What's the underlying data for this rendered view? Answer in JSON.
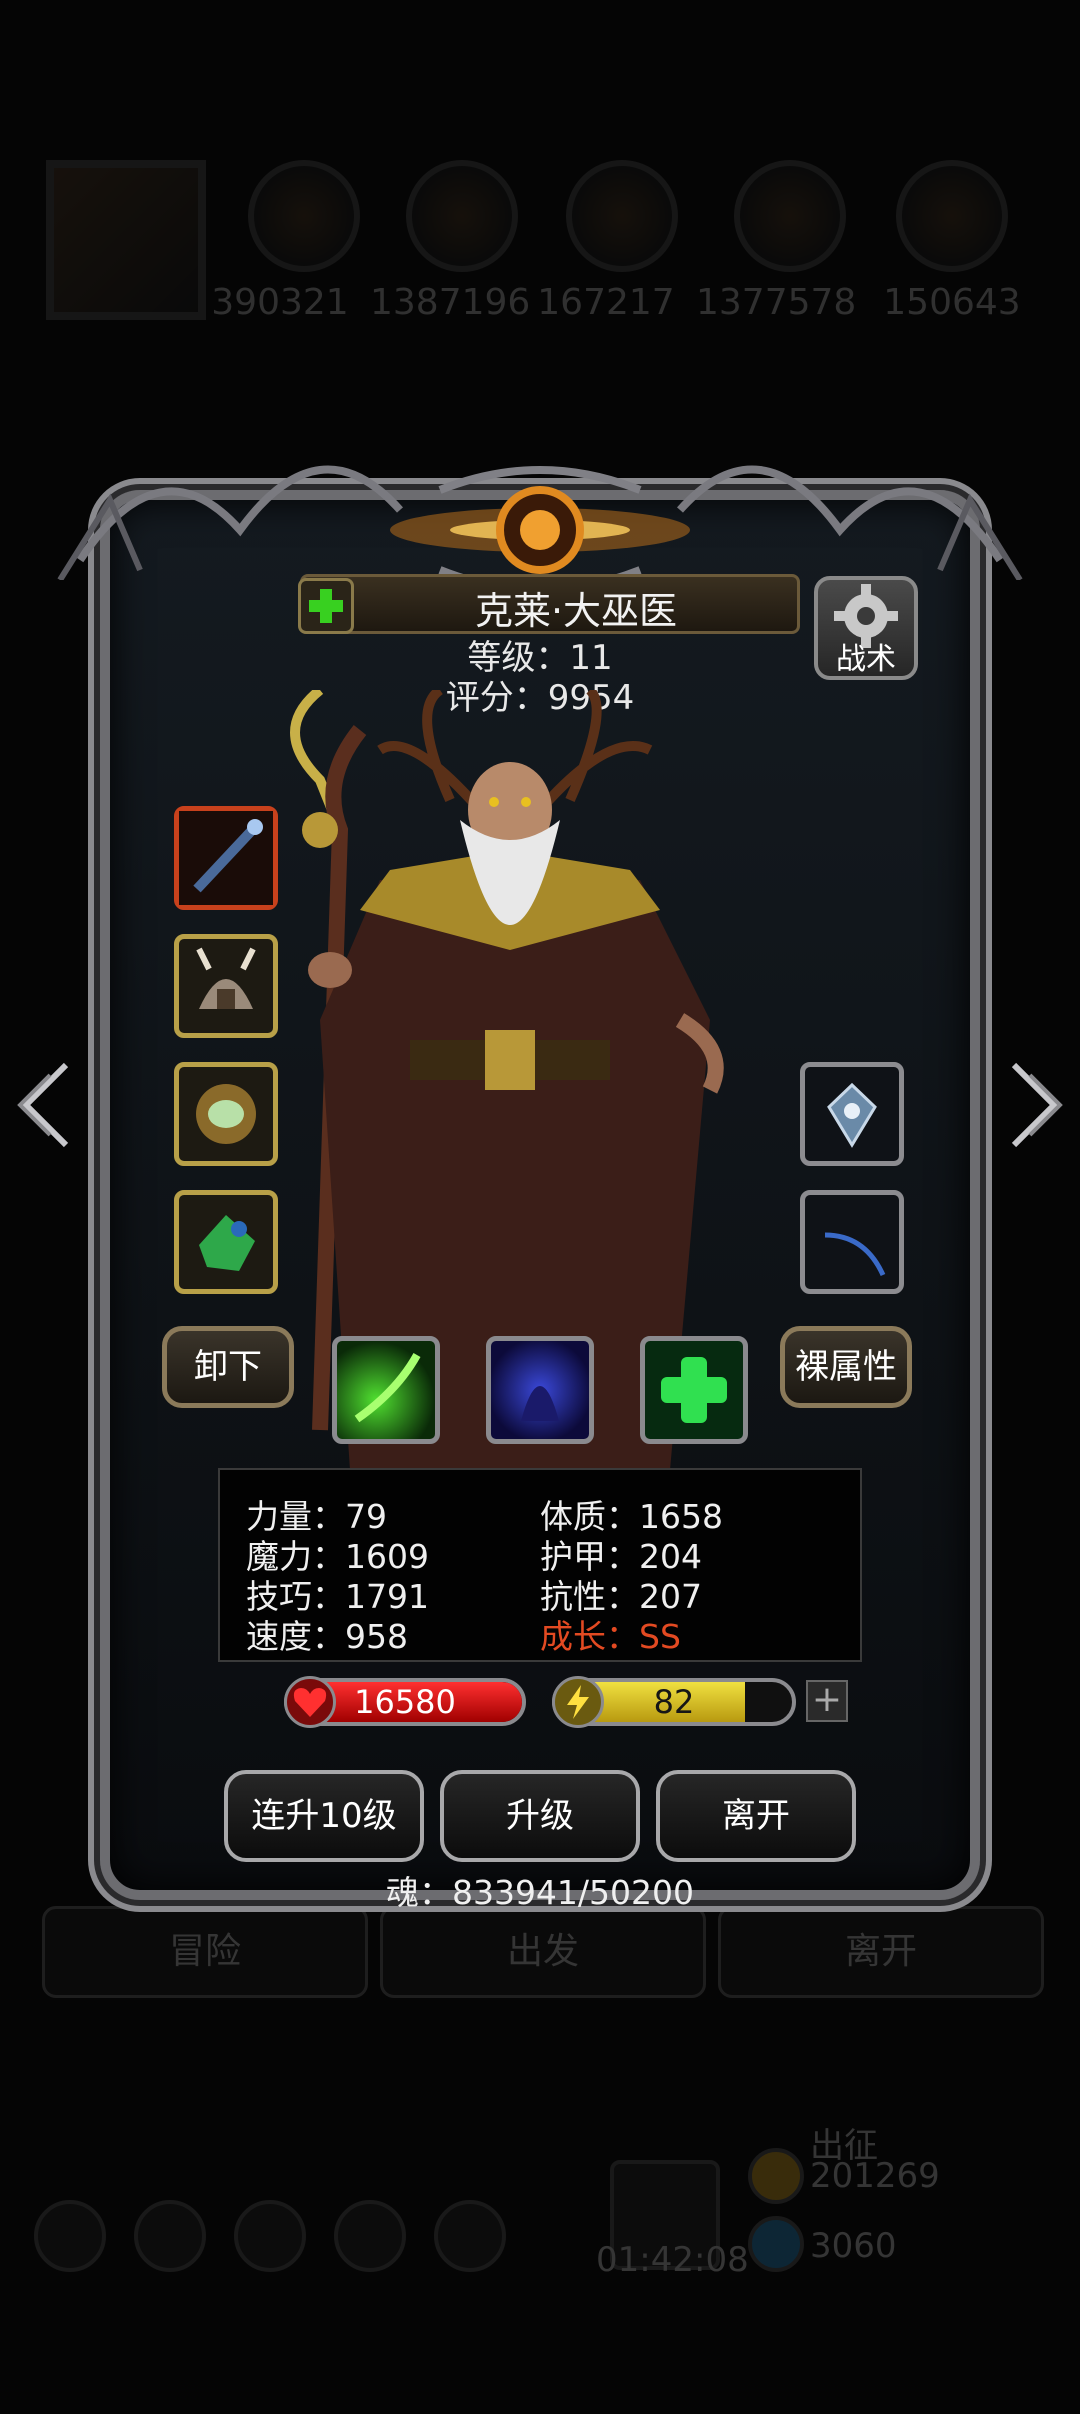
{
  "background": {
    "resources": [
      "390321",
      "1387196",
      "167217",
      "1377578",
      "150643"
    ],
    "bottom_buttons": [
      "冒险",
      "出发",
      "离开"
    ],
    "timer": "01:42:08",
    "currency_label": "出征",
    "currency_value": "201269",
    "gem_value": "3060"
  },
  "hero": {
    "name": "克莱·大巫医",
    "level_text": "等级：11",
    "score_text": "评分：9954",
    "tactics_label": "战术"
  },
  "buttons": {
    "unequip": "卸下",
    "base_attributes": "裸属性",
    "level_up_10": "连升10级",
    "level_up": "升级",
    "leave": "离开"
  },
  "stats": [
    "力量：79",
    "体质：1658",
    "魔力：1609",
    "护甲：204",
    "技巧：1791",
    "抗性：207",
    "速度：958",
    "成长：SS"
  ],
  "bars": {
    "hp": "16580",
    "energy": "82",
    "energy_fraction": 0.8,
    "plus": "+"
  },
  "soul_text": "魂：833941/50200",
  "colors": {
    "growth": "#e34a22",
    "hp": "#e02020",
    "energy": "#e8d030",
    "gold_frame": "#b8a048"
  },
  "icons": {
    "equipment_left": [
      "scepter-icon",
      "helmet-icon",
      "amulet-icon",
      "green-gem-icon"
    ],
    "equipment_right": [
      "emblem-icon",
      "blue-feather-icon"
    ],
    "skills": [
      "green-comet-icon",
      "shadow-spirit-icon",
      "heal-cross-icon"
    ]
  }
}
